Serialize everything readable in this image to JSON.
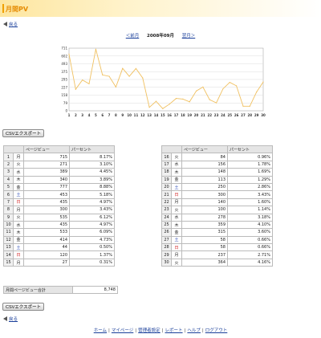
{
  "header": {
    "title": "月間PV"
  },
  "nav": {
    "back": "戻る",
    "prev": "＜前月",
    "current": "2008年09月",
    "next": "翌月＞"
  },
  "chart_data": {
    "type": "line",
    "categories": [
      "1",
      "2",
      "3",
      "4",
      "5",
      "6",
      "7",
      "8",
      "9",
      "10",
      "11",
      "12",
      "13",
      "14",
      "15",
      "16",
      "17",
      "18",
      "19",
      "20",
      "21",
      "22",
      "23",
      "24",
      "25",
      "26",
      "27",
      "28",
      "29",
      "30"
    ],
    "series": [
      {
        "values": [
          715,
          271,
          389,
          340,
          777,
          453,
          435,
          300,
          535,
          435,
          533,
          414,
          44,
          120,
          27,
          84,
          156,
          148,
          113,
          250,
          300,
          140,
          100,
          278,
          359,
          315,
          58,
          58,
          237,
          364
        ]
      }
    ],
    "ytick_labels": [
      "711",
      "602",
      "493",
      "375",
      "295",
      "227",
      "158",
      "79",
      "0"
    ],
    "ylim": [
      0,
      790
    ],
    "line_color": "#f0c060",
    "grid": true
  },
  "csv_button": "CSVエクスポート",
  "table": {
    "headers": {
      "views": "ページビュー",
      "percent": "パーセント"
    },
    "rows": [
      {
        "d": "1",
        "w": "月",
        "v": "715",
        "p": "8.17%"
      },
      {
        "d": "2",
        "w": "火",
        "v": "271",
        "p": "3.10%"
      },
      {
        "d": "3",
        "w": "水",
        "v": "389",
        "p": "4.45%"
      },
      {
        "d": "4",
        "w": "木",
        "v": "340",
        "p": "3.89%"
      },
      {
        "d": "5",
        "w": "金",
        "v": "777",
        "p": "8.88%"
      },
      {
        "d": "6",
        "w": "土",
        "v": "453",
        "p": "5.18%"
      },
      {
        "d": "7",
        "w": "日",
        "v": "435",
        "p": "4.97%"
      },
      {
        "d": "8",
        "w": "月",
        "v": "300",
        "p": "3.43%"
      },
      {
        "d": "9",
        "w": "火",
        "v": "535",
        "p": "6.12%"
      },
      {
        "d": "10",
        "w": "水",
        "v": "435",
        "p": "4.97%"
      },
      {
        "d": "11",
        "w": "木",
        "v": "533",
        "p": "6.09%"
      },
      {
        "d": "12",
        "w": "金",
        "v": "414",
        "p": "4.73%"
      },
      {
        "d": "13",
        "w": "土",
        "v": "44",
        "p": "0.50%"
      },
      {
        "d": "14",
        "w": "日",
        "v": "120",
        "p": "1.37%"
      },
      {
        "d": "15",
        "w": "月",
        "v": "27",
        "p": "0.31%"
      },
      {
        "d": "16",
        "w": "火",
        "v": "84",
        "p": "0.96%"
      },
      {
        "d": "17",
        "w": "水",
        "v": "156",
        "p": "1.78%"
      },
      {
        "d": "18",
        "w": "木",
        "v": "148",
        "p": "1.69%"
      },
      {
        "d": "19",
        "w": "金",
        "v": "113",
        "p": "1.29%"
      },
      {
        "d": "20",
        "w": "土",
        "v": "250",
        "p": "2.86%"
      },
      {
        "d": "21",
        "w": "日",
        "v": "300",
        "p": "3.43%"
      },
      {
        "d": "22",
        "w": "月",
        "v": "140",
        "p": "1.60%"
      },
      {
        "d": "23",
        "w": "火",
        "v": "100",
        "p": "1.14%"
      },
      {
        "d": "24",
        "w": "水",
        "v": "278",
        "p": "3.18%"
      },
      {
        "d": "25",
        "w": "木",
        "v": "359",
        "p": "4.10%"
      },
      {
        "d": "26",
        "w": "金",
        "v": "315",
        "p": "3.60%"
      },
      {
        "d": "27",
        "w": "土",
        "v": "58",
        "p": "0.66%"
      },
      {
        "d": "28",
        "w": "日",
        "v": "58",
        "p": "0.66%"
      },
      {
        "d": "29",
        "w": "月",
        "v": "237",
        "p": "2.71%"
      },
      {
        "d": "30",
        "w": "火",
        "v": "364",
        "p": "4.16%"
      }
    ]
  },
  "total": {
    "label": "月間ページビュー合計",
    "value": "8,748"
  },
  "footer": {
    "links": [
      "ホーム",
      "マイページ",
      "管理者設定",
      "レポート",
      "ヘルプ",
      "ログアウト"
    ]
  }
}
